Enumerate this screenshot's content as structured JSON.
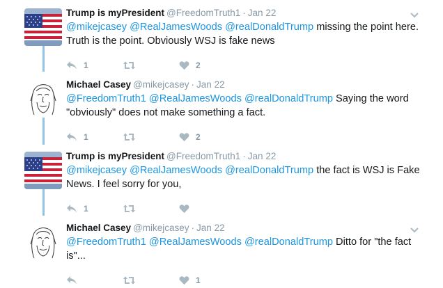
{
  "tweets": [
    {
      "name": "Trump is myPresident",
      "handle": "@FreedomTruth1",
      "dot": "·",
      "time": "Jan 22",
      "mentions": [
        "@mikejcasey",
        "@RealJamesWoods",
        "@realDonaldTrump"
      ],
      "text": "missing the point here. Truth is the point. Obviously WSJ is fake news",
      "reply_count": "1",
      "like_count": "2",
      "avatar": "american-flag-icon",
      "show_caret": true
    },
    {
      "name": "Michael Casey",
      "handle": "@mikejcasey",
      "dot": "·",
      "time": "Jan 22",
      "mentions": [
        "@FreedomTruth1",
        "@RealJamesWoods",
        "@realDonaldTrump"
      ],
      "text": "Saying the word \"obviously\" does not make something a fact.",
      "reply_count": "1",
      "like_count": "2",
      "avatar": "sketch-portrait-icon",
      "show_caret": false
    },
    {
      "name": "Trump is myPresident",
      "handle": "@FreedomTruth1",
      "dot": "·",
      "time": "Jan 22",
      "mentions": [
        "@mikejcasey",
        "@RealJamesWoods",
        "@realDonaldTrump"
      ],
      "text": "the fact is WSJ is Fake News. I feel sorry for you,",
      "reply_count": "1",
      "like_count": "",
      "avatar": "american-flag-icon",
      "show_caret": false
    },
    {
      "name": "Michael Casey",
      "handle": "@mikejcasey",
      "dot": "·",
      "time": "Jan 22",
      "mentions": [
        "@FreedomTruth1",
        "@RealJamesWoods",
        "@realDonaldTrump"
      ],
      "text": "Ditto for \"the fact is\"...",
      "reply_count": "",
      "like_count": "1",
      "avatar": "sketch-portrait-icon",
      "show_caret": true
    }
  ],
  "colors": {
    "link": "#1b95e0",
    "thread_line": "#92c3e7",
    "muted": "#8899a6",
    "icon": "#aab8c2"
  }
}
